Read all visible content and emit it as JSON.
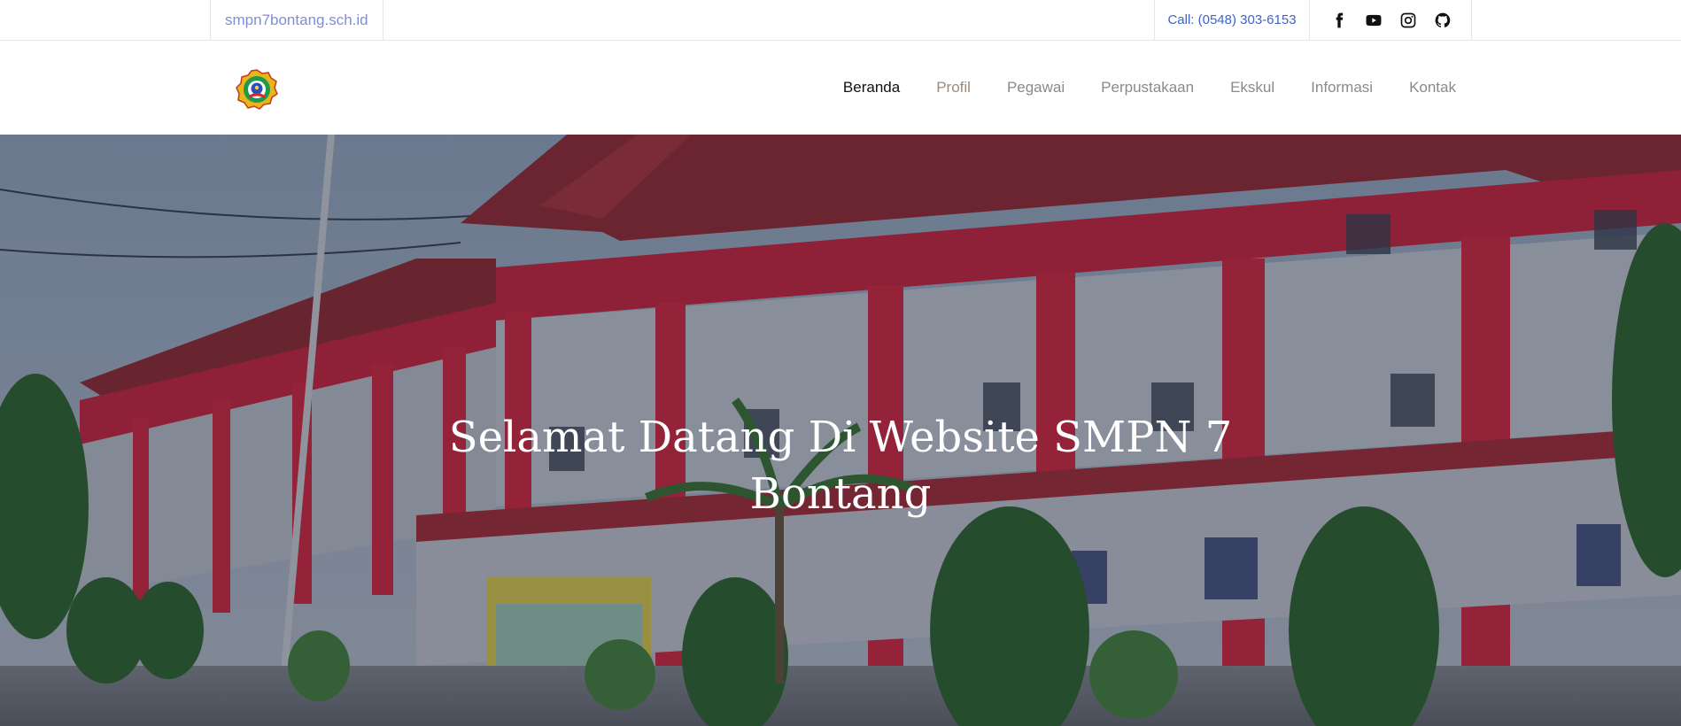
{
  "topbar": {
    "domain": "smpn7bontang.sch.id",
    "call": "Call: (0548) 303-6153",
    "socials": [
      "facebook-icon",
      "youtube-icon",
      "instagram-icon",
      "github-icon"
    ]
  },
  "nav": {
    "items": [
      {
        "label": "Beranda",
        "active": true
      },
      {
        "label": "Profil"
      },
      {
        "label": "Pegawai"
      },
      {
        "label": "Perpustakaan"
      },
      {
        "label": "Ekskul"
      },
      {
        "label": "Informasi"
      },
      {
        "label": "Kontak"
      }
    ]
  },
  "hero": {
    "title": "Selamat Datang Di Website SMPN 7 Bontang"
  },
  "colors": {
    "link": "#3f63c8",
    "domain": "#7d8fd6",
    "building_red": "#d8243a"
  }
}
